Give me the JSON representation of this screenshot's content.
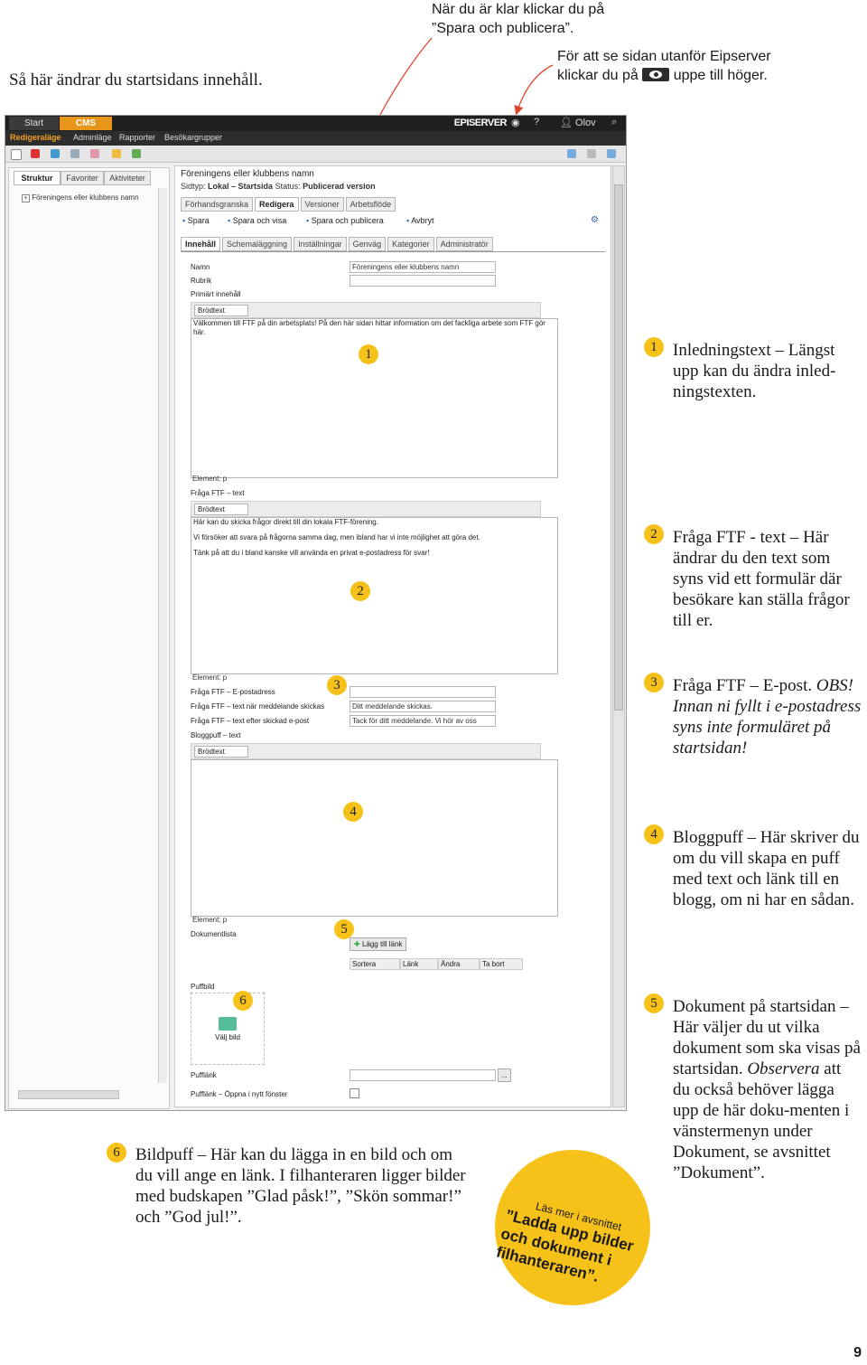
{
  "intro": "Så här ändrar du startsidans innehåll.",
  "note_top": [
    "När du är klar klickar du på",
    "”Spara och publicera”."
  ],
  "note_right": {
    "line1": "För att se sidan utanför Eipserver",
    "line2_before": "klickar du på",
    "line2_after": "uppe till höger."
  },
  "cms": {
    "topbar": {
      "tab_start": "Start",
      "tab_cms": "CMS",
      "brand": "EPISERVER",
      "help": "?",
      "user": "Olov"
    },
    "menu": [
      "Redigeraläge",
      "Adminläge",
      "Rapporter",
      "Besökargrupper"
    ],
    "left_tabs": [
      "Struktur",
      "Favoriter",
      "Aktiviteter"
    ],
    "tree_item": "Föreningens eller klubbens namn",
    "page_name": "Föreningens eller klubbens namn",
    "meta": {
      "sidtyp_label": "Sidtyp:",
      "sidtyp": "Lokal – Startsida",
      "status_label": "Status:",
      "status": "Publicerad version"
    },
    "edit_tabs": [
      "Förhandsgranska",
      "Redigera",
      "Versioner",
      "Arbetsflöde"
    ],
    "actions": [
      "Spara",
      "Spara och visa",
      "Spara och publicera",
      "Avbryt"
    ],
    "sub_tabs": [
      "Innehåll",
      "Schemaläggning",
      "Inställningar",
      "Genväg",
      "Kategorier",
      "Administratör"
    ],
    "fields": {
      "namn_label": "Namn",
      "namn_value": "Föreningens eller klubbens namn",
      "rubrik_label": "Rubrik",
      "primart_label": "Primärt innehåll",
      "format": "Brödtext",
      "intro_text": "Välkommen till FTF på din arbetsplats! På den här sidan hittar information om det fackliga arbete som FTF gör här.",
      "element": "Element: p",
      "fraga_label": "Fråga FTF – text",
      "fraga_lines": [
        "Här kan du skicka frågor direkt till din lokala FTF-förening.",
        "Vi försöker att svara på frågorna samma dag, men ibland har vi inte möjlighet att göra det.",
        "Tänk på att du i bland kanske vill använda en privat e-postadress för svar!"
      ],
      "epost_label": "Fråga FTF – E-postadress",
      "skickas_label": "Fråga FTF – text när meddelande skickas",
      "skickas_value": "Ditt meddelande skickas.",
      "efter_label": "Fråga FTF – text efter skickad e-post",
      "efter_value": "Tack för ditt meddelande. Vi hör av oss",
      "blogg_label": "Bloggpuff – text",
      "doklista_label": "Dokumentlista",
      "lagg_till": "Lägg till länk",
      "dok_cols": [
        "Sortera",
        "Länk",
        "Ändra",
        "Ta bort"
      ],
      "puffbild_label": "Puffbild",
      "valj_bild": "Välj bild",
      "pufflank_label": "Pufflänk",
      "pufflank_btn": "...",
      "pufflank_ny_label": "Pufflänk – Öppna i nytt fönster"
    }
  },
  "markers": [
    "1",
    "2",
    "3",
    "4",
    "5",
    "6"
  ],
  "callouts": {
    "c1": "Inledningstext – Längst upp kan du ändra inled-ningstexten.",
    "c2": "Fråga FTF - text – Här ändrar du den text som syns vid ett formulär där besökare kan ställa frågor till er.",
    "c3_plain": "Fråga FTF – E-post.",
    "c3_italic": "OBS! Innan ni fyllt i e-postadress syns inte formuläret på startsidan!",
    "c4": "Bloggpuff – Här skriver du om du vill skapa en puff med text och länk till en blogg, om ni har en sådan.",
    "c5_a": "Dokument på startsidan – Här väljer du ut vilka dokument som ska visas på startsidan.",
    "c5_italic": "Observera",
    "c5_b": "att du också behöver lägga upp de här doku-menten i vänstermenyn under Dokument, se avsnittet ”Dokument”.",
    "c6": "Bildpuff – Här kan du lägga in en bild och om du vill ange en länk. I filhanteraren ligger bilder med budskapen ”Glad påsk!”, ”Skön sommar!” och ”God jul!”."
  },
  "circle": {
    "small": "Läs mer i avsnittet",
    "big": "”Ladda upp bilder och dokument i filhanteraren”."
  },
  "page_number": "9",
  "colors": {
    "accent": "#f6c21a",
    "cms_orange": "#e8961a",
    "arrow": "#e0452d"
  }
}
